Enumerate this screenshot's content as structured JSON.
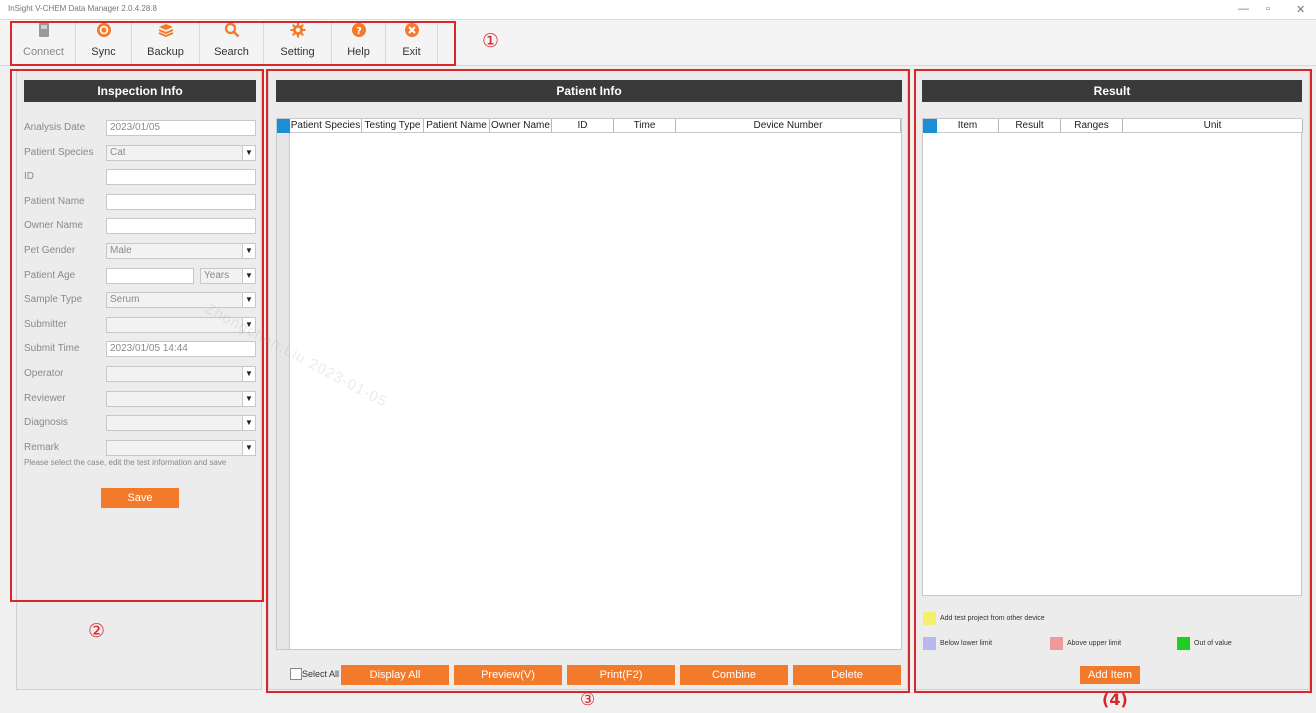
{
  "window": {
    "title": "InSight V-CHEM Data Manager 2.0.4.28.8",
    "controls": [
      "—",
      "▫",
      "✕"
    ]
  },
  "toolbar": {
    "items": [
      {
        "label": "Connect",
        "icon": "device-icon",
        "enabled": false
      },
      {
        "label": "Sync",
        "icon": "sync-icon",
        "enabled": true
      },
      {
        "label": "Backup",
        "icon": "backup-icon",
        "enabled": true
      },
      {
        "label": "Search",
        "icon": "search-icon",
        "enabled": true
      },
      {
        "label": "Setting",
        "icon": "gear-icon",
        "enabled": true
      },
      {
        "label": "Help",
        "icon": "help-icon",
        "enabled": true
      },
      {
        "label": "Exit",
        "icon": "close-icon",
        "enabled": true
      }
    ]
  },
  "callouts": [
    "①",
    "②",
    "③",
    "(4)"
  ],
  "inspection": {
    "title": "Inspection Info",
    "fields": [
      {
        "label": "Analysis Date",
        "value": "2023/01/05",
        "type": "text"
      },
      {
        "label": "Patient Species",
        "value": "Cat",
        "type": "select"
      },
      {
        "label": "ID",
        "value": "",
        "type": "text"
      },
      {
        "label": "Patient Name",
        "value": "",
        "type": "text"
      },
      {
        "label": "Owner Name",
        "value": "",
        "type": "text"
      },
      {
        "label": "Pet Gender",
        "value": "Male",
        "type": "select"
      },
      {
        "label": "Patient Age",
        "value": "",
        "type": "age"
      },
      {
        "label": "Sample Type",
        "value": "Serum",
        "type": "select"
      },
      {
        "label": "Submitter",
        "value": "",
        "type": "select"
      },
      {
        "label": "Submit Time",
        "value": "2023/01/05 14:44",
        "type": "text"
      },
      {
        "label": "Operator",
        "value": "",
        "type": "select"
      },
      {
        "label": "Reviewer",
        "value": "",
        "type": "select"
      },
      {
        "label": "Diagnosis",
        "value": "",
        "type": "select"
      },
      {
        "label": "Remark",
        "value": "",
        "type": "select"
      }
    ],
    "age_unit": "Years",
    "hint": "Please select the case, edit the test information and save",
    "save_label": "Save"
  },
  "patient": {
    "title": "Patient Info",
    "columns": [
      "Patient Species",
      "Testing Type",
      "Patient Name",
      "Owner Name",
      "ID",
      "Time",
      "Device Number"
    ],
    "select_all": "Select All",
    "buttons": [
      "Display All",
      "Preview(V)",
      "Print(F2)",
      "Combine",
      "Delete"
    ]
  },
  "result": {
    "title": "Result",
    "columns": [
      "Item",
      "Result",
      "Ranges",
      "Unit"
    ],
    "legend": [
      {
        "label": "Add test project from other device",
        "color": "#f5f06a"
      },
      {
        "label": "Below lower limit",
        "color": "#b8b8ee"
      },
      {
        "label": "Above upper limit",
        "color": "#f0999a"
      },
      {
        "label": "Out of value",
        "color": "#22cc22"
      }
    ],
    "add_label": "Add Item"
  },
  "watermark": "Zhongchen.Liu 2023-01-05",
  "colors": {
    "accent": "#f27a2a",
    "header": "#3a3a3a",
    "highlight": "#d8262c",
    "selection": "#1a8fd8"
  }
}
